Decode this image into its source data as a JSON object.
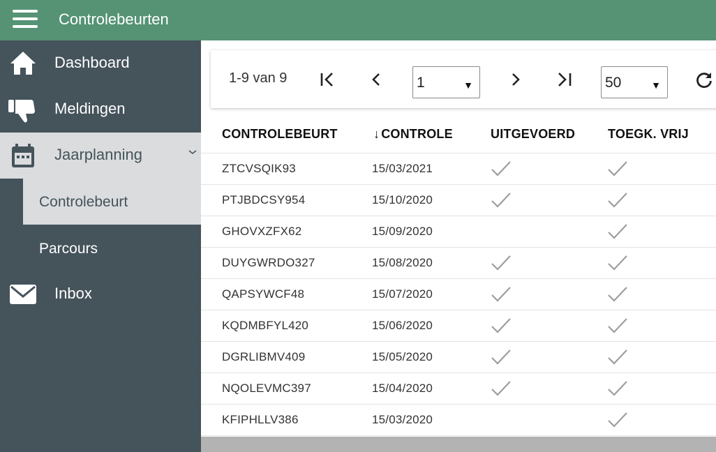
{
  "header": {
    "title": "Controlebeurten",
    "menu_icon": "hamburger-icon"
  },
  "sidebar": {
    "items": [
      {
        "label": "Dashboard",
        "icon": "home-icon"
      },
      {
        "label": "Meldingen",
        "icon": "thumbs-down-icon"
      },
      {
        "label": "Jaarplanning",
        "icon": "calendar-icon",
        "expanded": true
      },
      {
        "label": "Inbox",
        "icon": "mail-icon"
      }
    ],
    "subitems": [
      {
        "label": "Controlebeurt",
        "active": true
      },
      {
        "label": "Parcours",
        "active": false
      }
    ]
  },
  "pager": {
    "range": "1-9 van 9",
    "page_value": "1",
    "page_size": "50"
  },
  "table": {
    "columns": [
      "CONTROLEBEURT",
      "CONTROLE",
      "UITGEVOERD",
      "TOEGK. VRIJ"
    ],
    "sort_indicator": "↓",
    "rows": [
      {
        "code": "ZTCVSQIK93",
        "date": "15/03/2021",
        "uitgevoerd": true,
        "vrij": true
      },
      {
        "code": "PTJBDCSY954",
        "date": "15/10/2020",
        "uitgevoerd": true,
        "vrij": true
      },
      {
        "code": "GHOVXZFX62",
        "date": "15/09/2020",
        "uitgevoerd": false,
        "vrij": true
      },
      {
        "code": "DUYGWRDO327",
        "date": "15/08/2020",
        "uitgevoerd": true,
        "vrij": true
      },
      {
        "code": "QAPSYWCF48",
        "date": "15/07/2020",
        "uitgevoerd": true,
        "vrij": true
      },
      {
        "code": "KQDMBFYL420",
        "date": "15/06/2020",
        "uitgevoerd": true,
        "vrij": true
      },
      {
        "code": "DGRLIBMV409",
        "date": "15/05/2020",
        "uitgevoerd": true,
        "vrij": true
      },
      {
        "code": "NQOLEVMC397",
        "date": "15/04/2020",
        "uitgevoerd": true,
        "vrij": true
      },
      {
        "code": "KFIPHLLV386",
        "date": "15/03/2020",
        "uitgevoerd": false,
        "vrij": true
      }
    ]
  },
  "colors": {
    "header": "#559374",
    "sidebar": "#45535b",
    "selected": "#dadcde",
    "check": "#9e9e9e"
  }
}
